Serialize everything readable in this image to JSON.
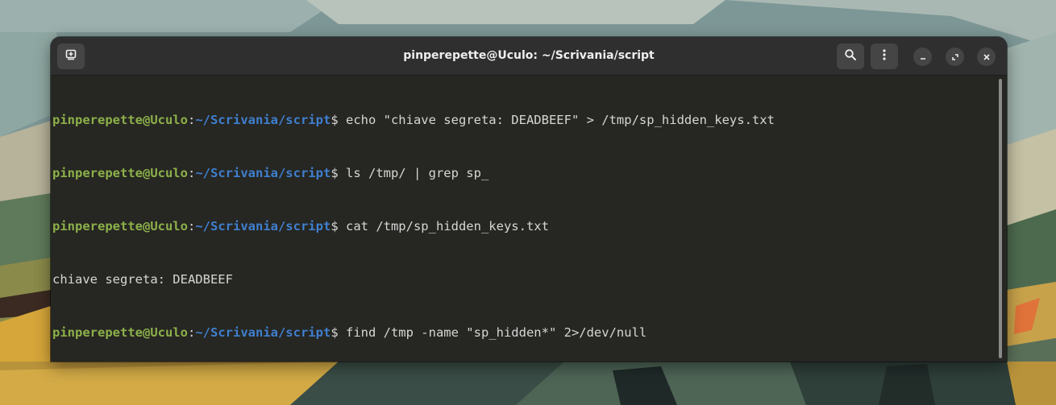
{
  "window": {
    "title": "pinperepette@Uculo: ~/Scrivania/script"
  },
  "icons": {
    "new_tab": "new-tab-icon",
    "search": "search-icon",
    "menu": "kebab-menu-icon",
    "minimize": "minimize-icon",
    "maximize": "maximize-icon",
    "close": "close-icon"
  },
  "colors": {
    "terminal_bg": "#262622",
    "user_host": "#8cb04a",
    "path": "#3f7fcf",
    "text": "#d6d6d6"
  },
  "terminal": {
    "user_host": "pinperepette@Uculo",
    "path": "~/Scrivania/script",
    "lines": [
      {
        "type": "prompt",
        "sep": ":",
        "dollar": "$",
        "command": " echo \"chiave segreta: DEADBEEF\" > /tmp/sp_hidden_keys.txt"
      },
      {
        "type": "prompt",
        "sep": ":",
        "dollar": "$",
        "command": " ls /tmp/ | grep sp_"
      },
      {
        "type": "prompt",
        "sep": ":",
        "dollar": "$",
        "command": " cat /tmp/sp_hidden_keys.txt"
      },
      {
        "type": "output",
        "text": "chiave segreta: DEADBEEF"
      },
      {
        "type": "prompt",
        "sep": ":",
        "dollar": "$",
        "command": " find /tmp -name \"sp_hidden*\" 2>/dev/null"
      },
      {
        "type": "prompt",
        "sep": ":",
        "dollar": "$",
        "command": " "
      }
    ]
  }
}
